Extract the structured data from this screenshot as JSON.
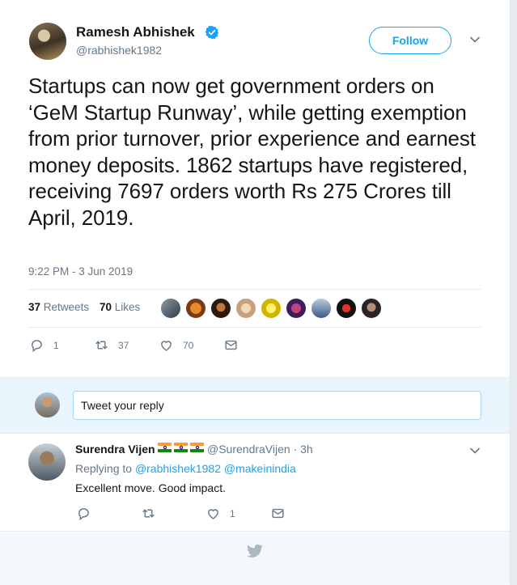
{
  "tweet": {
    "author_name": "Ramesh Abhishek",
    "handle": "@rabhishek1982",
    "follow_label": "Follow",
    "text": "Startups can now get government orders on ‘GeM Startup Runway’, while getting exemption from prior turnover, prior experience and earnest money deposits. 1862 startups have registered, receiving 7697 orders worth Rs 275 Crores till April, 2019.",
    "timestamp": "9:22 PM - 3 Jun 2019",
    "retweets_count": "37",
    "retweets_label": "Retweets",
    "likes_count": "70",
    "likes_label": "Likes",
    "actions": {
      "replies": "1",
      "retweets": "37",
      "likes": "70"
    }
  },
  "reply_box": {
    "placeholder": "Tweet your reply"
  },
  "reply": {
    "author_name": "Surendra Vijen",
    "handle_time": "@SurendraVijen · 3h",
    "replying_prefix": "Replying to",
    "mention_1": "@rabhishek1982",
    "mention_2": "@makeinindia",
    "text": "Excellent move. Good impact.",
    "actions": {
      "replies": "",
      "retweets": "",
      "likes": "1"
    }
  },
  "colors": {
    "accent": "#1da1f2",
    "muted": "#657786",
    "text": "#14171a"
  },
  "icons": [
    "verified-icon",
    "chevron-down-icon",
    "reply-icon",
    "retweet-icon",
    "like-icon",
    "message-icon",
    "twitter-bird-icon",
    "flag-india-icon"
  ]
}
